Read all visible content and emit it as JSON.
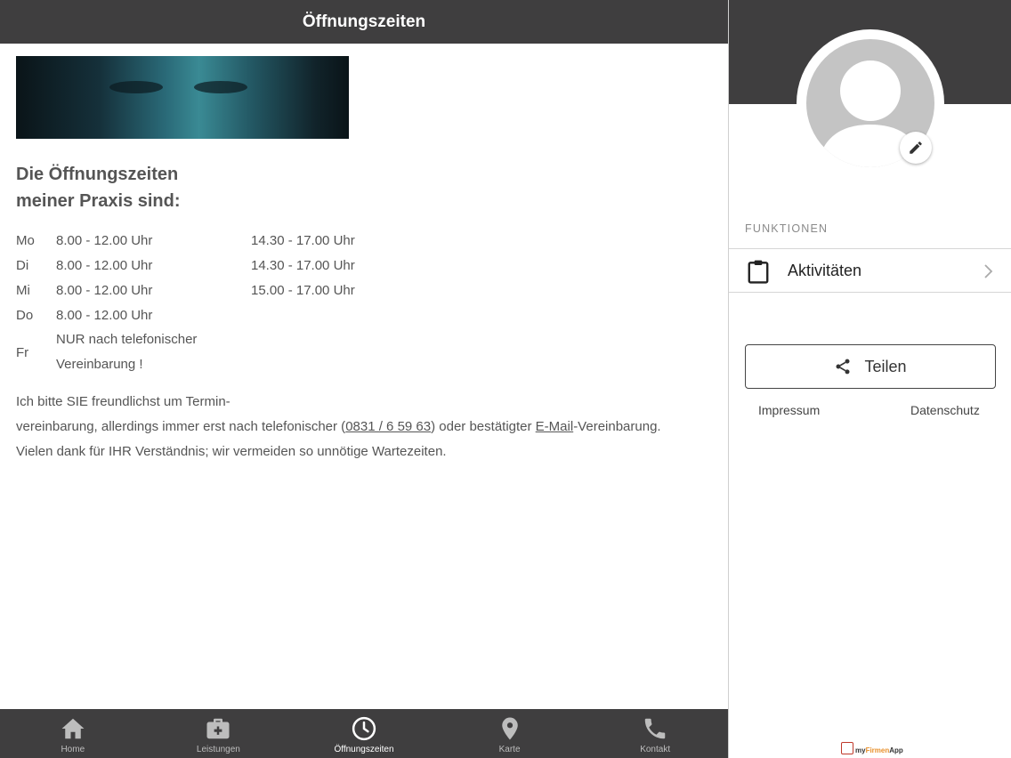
{
  "header": {
    "title": "Öffnungszeiten"
  },
  "content": {
    "heading_line1": "Die Öffnungszeiten",
    "heading_line2": "meiner Praxis sind:",
    "hours": [
      {
        "day": "Mo",
        "am": "8.00 - 12.00 Uhr",
        "pm": "14.30 - 17.00 Uhr"
      },
      {
        "day": "Di",
        "am": "8.00 - 12.00 Uhr",
        "pm": "14.30 - 17.00 Uhr"
      },
      {
        "day": "Mi",
        "am": "8.00 - 12.00 Uhr",
        "pm": "15.00 - 17.00 Uhr"
      },
      {
        "day": "Do",
        "am": "8.00 - 12.00 Uhr",
        "pm": ""
      }
    ],
    "friday": {
      "day": "Fr",
      "line1": "NUR nach telefonischer",
      "line2": "Vereinbarung !"
    },
    "note": {
      "line1": "Ich bitte SIE freundlichst um Termin-",
      "line2_pre": "vereinbarung, allerdings immer erst nach telefonischer (",
      "phone": "0831 / 6 59 63",
      "line2_mid": ") oder bestätigter ",
      "email_link": "E-Mail",
      "line2_post": "-Vereinbarung.",
      "line3": "Vielen dank für IHR Verständnis; wir vermeiden so unnötige Wartezeiten."
    }
  },
  "tabbar": {
    "tabs": [
      {
        "label": "Home",
        "icon": "home-icon"
      },
      {
        "label": "Leistungen",
        "icon": "briefcase-medical-icon"
      },
      {
        "label": "Öffnungszeiten",
        "icon": "clock-icon",
        "active": true
      },
      {
        "label": "Karte",
        "icon": "map-pin-icon"
      },
      {
        "label": "Kontakt",
        "icon": "phone-icon"
      }
    ]
  },
  "sidebar": {
    "section_label": "FUNKTIONEN",
    "menu_item": "Aktivitäten",
    "share_label": "Teilen",
    "impressum": "Impressum",
    "datenschutz": "Datenschutz",
    "brand_prefix": "my",
    "brand_accent": "Firmen",
    "brand_suffix": "App"
  },
  "colors": {
    "bar": "#3f3e3f",
    "text": "#555555",
    "avatar": "#c4c4c4"
  }
}
